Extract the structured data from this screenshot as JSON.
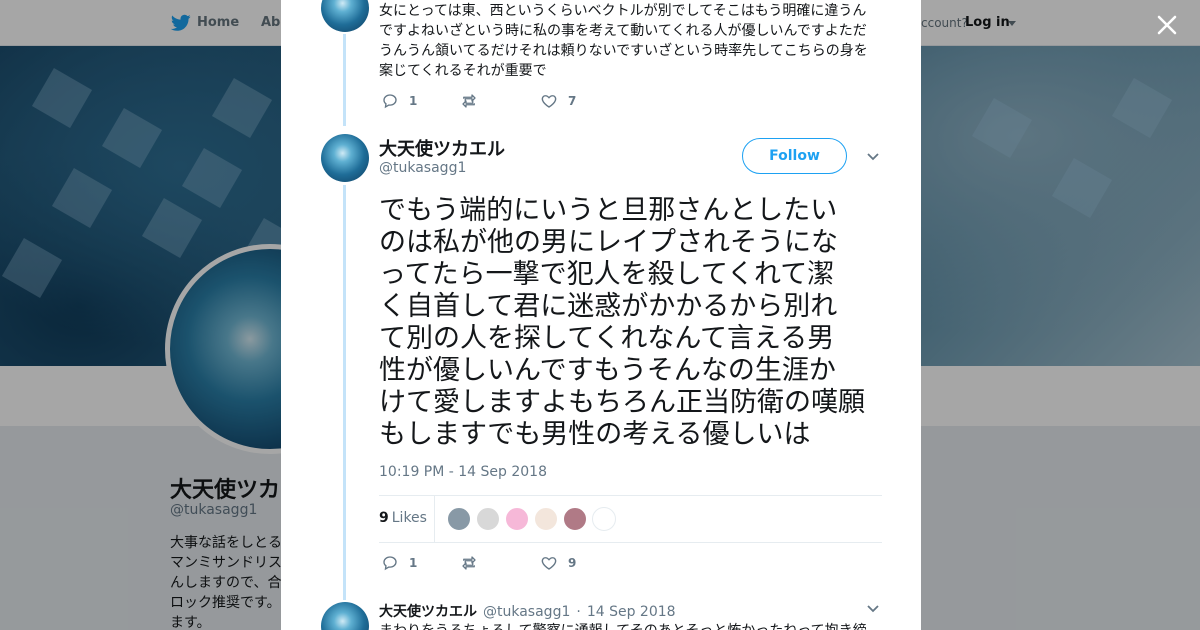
{
  "topbar": {
    "home_label": "Home",
    "about_label": "Abo",
    "account_prompt": "ccount?",
    "login_label": "Log in"
  },
  "profile": {
    "name": "大天使ツカエ",
    "handle": "@tukasagg1",
    "bio_lines": [
      "大事な話をしとる",
      "マンミサンドリス",
      "んしますので、合",
      "ロック推奨です。",
      "ます。"
    ]
  },
  "modal": {
    "close_icon": "close-icon",
    "prev_tweet": {
      "text_lines": [
        "女にとっては東、西というくらいベクトルが別でしてそこはもう明確に違うん",
        "ですよねいざという時に私の事を考えて動いてくれる人が優しいんですよただ",
        "うんうん頷いてるだけそれは頼りないですいざという時率先してこちらの身を",
        "案じてくれるそれが重要で"
      ],
      "reply_count": "1",
      "retweet_count": "",
      "like_count": "7"
    },
    "main_tweet": {
      "author_name": "大天使ツカエル",
      "author_handle": "@tukasagg1",
      "follow_label": "Follow",
      "text_lines": [
        "でもう端的にいうと旦那さんとしたい",
        "のは私が他の男にレイプされそうにな",
        "ってたら一撃で犯人を殺してくれて潔",
        "く自首して君に迷惑がかかるから別れ",
        "て別の人を探してくれなんて言える男",
        "性が優しいんですもうそんなの生涯か",
        "けて愛しますよもちろん正当防衛の嘆願",
        "もしますでも男性の考える優しいは"
      ],
      "timestamp": "10:19 PM - 14 Sep 2018",
      "likes_number": "9",
      "likes_label": "Likes",
      "reply_count": "1",
      "retweet_count": "",
      "like_count": "9",
      "liker_colors": [
        "#8899a6",
        "#d8d8d8",
        "#f6b8d8",
        "#f3e6dc",
        "#b07a86",
        "#ffffff"
      ]
    },
    "next_tweet": {
      "author_name": "大天使ツカエル",
      "author_handle": "@tukasagg1",
      "separator": "·",
      "date": "14 Sep 2018",
      "text": "まわりをうろちょろして警察に通報してそのあとそっと怖かったねって抱き締"
    }
  },
  "colors": {
    "accent": "#1da1f2",
    "muted": "#657786",
    "thread_line": "#c4e3f9"
  }
}
